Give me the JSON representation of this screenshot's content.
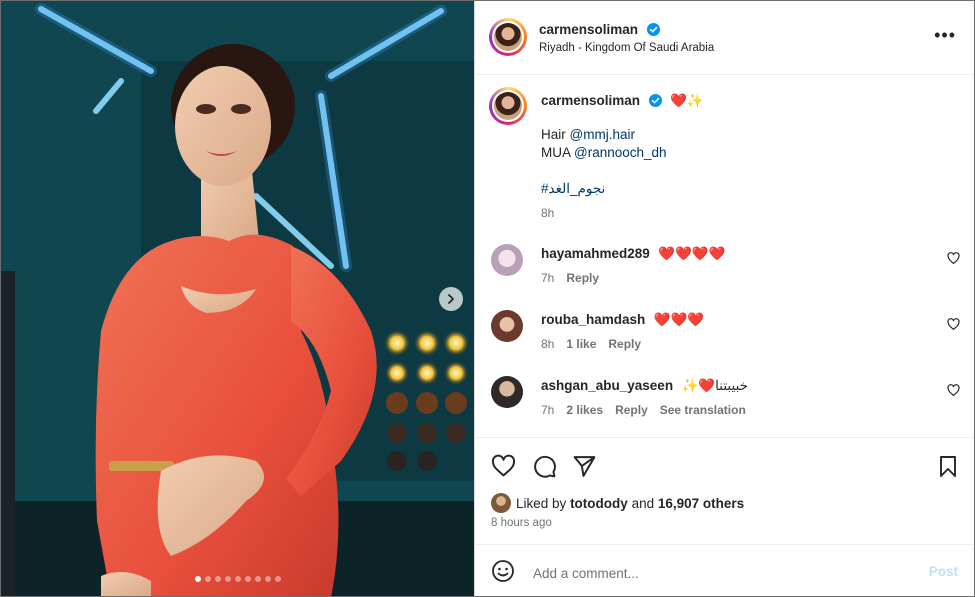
{
  "post": {
    "username": "carmensoliman",
    "location": "Riyadh - Kingdom Of Saudi Arabia",
    "verified": true
  },
  "caption": {
    "username": "carmensoliman",
    "emojis": "❤️✨",
    "line1_prefix": "Hair ",
    "line1_mention": "@mmj.hair",
    "line2_prefix": "MUA ",
    "line2_mention": "@rannooch_dh",
    "hashtag": "#نجوم_الغد",
    "time": "8h"
  },
  "comments": [
    {
      "username": "hayamahmed289",
      "text": "❤️❤️❤️❤️",
      "time": "7h",
      "likes": "",
      "reply": "Reply",
      "translate": ""
    },
    {
      "username": "rouba_hamdash",
      "text": "❤️❤️❤️",
      "time": "8h",
      "likes": "1 like",
      "reply": "Reply",
      "translate": ""
    },
    {
      "username": "ashgan_abu_yaseen",
      "text": "✨❤️خبيبتنا",
      "time": "7h",
      "likes": "2 likes",
      "reply": "Reply",
      "translate": "See translation"
    }
  ],
  "likes": {
    "prefix": "Liked by ",
    "user": "totodody",
    "middle": " and ",
    "count": "16,907 others"
  },
  "post_time": "8 hours ago",
  "add_comment": {
    "placeholder": "Add a comment...",
    "post_label": "Post"
  },
  "carousel": {
    "total": 9,
    "active_index": 0
  },
  "colors": {
    "accent": "#0095f6",
    "heart": "#ed4956",
    "link": "#00376b"
  }
}
